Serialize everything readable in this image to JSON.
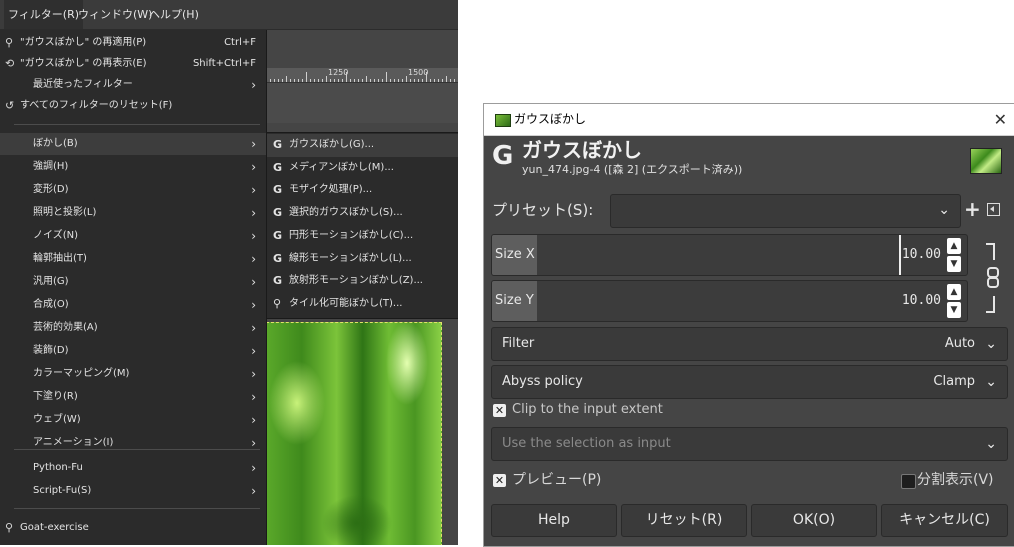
{
  "menubar": {
    "items": [
      "フィルター(R)",
      "ウィンドウ(W)",
      "ヘルプ(H)"
    ]
  },
  "ruler": {
    "labels": [
      "1250",
      "1500"
    ]
  },
  "filters_menu": {
    "top_items": [
      {
        "icon": "reapply-icon",
        "label": "\"ガウスぼかし\" の再適用(P)",
        "shortcut": "Ctrl+F"
      },
      {
        "icon": "reshow-icon",
        "label": "\"ガウスぼかし\" の再表示(E)",
        "shortcut": "Shift+Ctrl+F"
      },
      {
        "icon": "",
        "label": "最近使ったフィルター",
        "shortcut": ""
      },
      {
        "icon": "reset-icon",
        "label": "すべてのフィルターのリセット(F)",
        "shortcut": ""
      }
    ],
    "category_items": [
      "ぼかし(B)",
      "強調(H)",
      "変形(D)",
      "照明と投影(L)",
      "ノイズ(N)",
      "輪郭抽出(T)",
      "汎用(G)",
      "合成(O)",
      "芸術的効果(A)",
      "装飾(D)",
      "カラーマッピング(M)",
      "下塗り(R)",
      "ウェブ(W)",
      "アニメーション(I)"
    ],
    "script_items": [
      "Python-Fu",
      "Script-Fu(S)"
    ],
    "bottom_item": "Goat-exercise"
  },
  "blur_submenu": {
    "items": [
      {
        "icon": "G",
        "label": "ガウスぼかし(G)..."
      },
      {
        "icon": "G",
        "label": "メディアンぼかし(M)..."
      },
      {
        "icon": "G",
        "label": "モザイク処理(P)..."
      },
      {
        "icon": "G",
        "label": "選択的ガウスぼかし(S)..."
      },
      {
        "icon": "G",
        "label": "円形モーションぼかし(C)..."
      },
      {
        "icon": "G",
        "label": "線形モーションぼかし(L)..."
      },
      {
        "icon": "G",
        "label": "放射形モーションぼかし(Z)..."
      },
      {
        "icon": "script",
        "label": "タイル化可能ぼかし(T)..."
      }
    ]
  },
  "dialog": {
    "window_title": "ガウスぼかし",
    "header_title": "ガウスぼかし",
    "header_subtitle": "yun_474.jpg-4 ([森 2] (エクスポート済み))",
    "preset_label": "プリセット(S):",
    "preset_value": "",
    "size_x_label": "Size X",
    "size_x_value": "10.00",
    "size_y_label": "Size Y",
    "size_y_value": "10.00",
    "filter_label": "Filter",
    "filter_value": "Auto",
    "abyss_label": "Abyss policy",
    "abyss_value": "Clamp",
    "clip_label": "Clip to the input extent",
    "clip_checked": true,
    "selection_input_label": "Use the selection as input",
    "preview_label": "プレビュー(P)",
    "preview_checked": true,
    "split_view_label": "分割表示(V)",
    "split_view_checked": false,
    "buttons": {
      "help": "Help",
      "reset": "リセット(R)",
      "ok": "OK(O)",
      "cancel": "キャンセル(C)"
    }
  }
}
